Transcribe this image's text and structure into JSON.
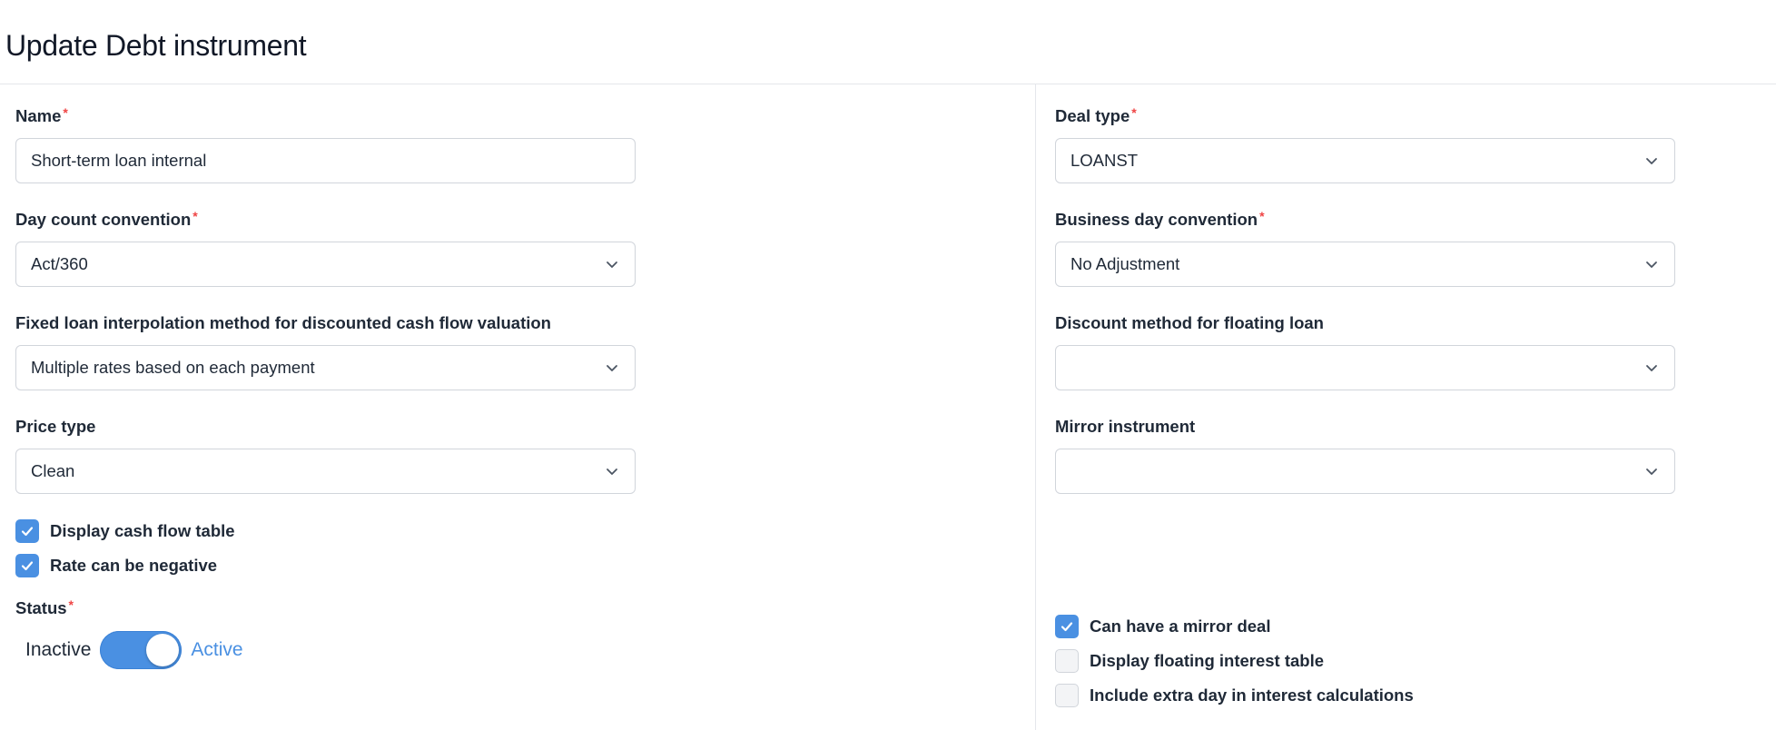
{
  "page": {
    "title": "Update Debt instrument"
  },
  "left": {
    "name": {
      "label": "Name",
      "required": "*",
      "value": "Short-term loan internal"
    },
    "day_count": {
      "label": "Day count convention",
      "required": "*",
      "value": "Act/360"
    },
    "fixed_interp": {
      "label": "Fixed loan interpolation method for discounted cash flow valuation",
      "value": "Multiple rates based on each payment"
    },
    "price_type": {
      "label": "Price type",
      "value": "Clean"
    },
    "checkboxes": [
      {
        "label": "Display cash flow table",
        "checked": true
      },
      {
        "label": "Rate can be negative",
        "checked": true
      }
    ],
    "status": {
      "label": "Status",
      "required": "*",
      "off_label": "Inactive",
      "on_label": "Active",
      "on": true
    }
  },
  "right": {
    "deal_type": {
      "label": "Deal type",
      "required": "*",
      "value": "LOANST"
    },
    "business_day": {
      "label": "Business day convention",
      "required": "*",
      "value": "No Adjustment"
    },
    "discount_method": {
      "label": "Discount method for floating loan",
      "value": ""
    },
    "mirror_instrument": {
      "label": "Mirror instrument",
      "value": ""
    },
    "checkboxes": [
      {
        "label": "Can have a mirror deal",
        "checked": true
      },
      {
        "label": "Display floating interest table",
        "checked": false
      },
      {
        "label": "Include extra day in interest calculations",
        "checked": false
      }
    ]
  },
  "colors": {
    "accent": "#4a90e2",
    "required": "#ef4444",
    "border": "#d1d5db"
  }
}
